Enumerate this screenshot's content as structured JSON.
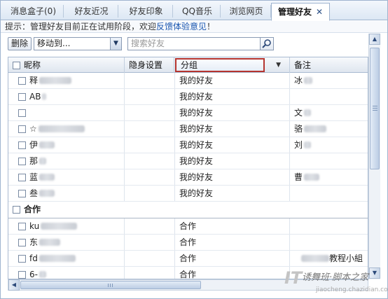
{
  "tabs": [
    {
      "label": "消息盒子(0)",
      "active": false
    },
    {
      "label": "好友近况",
      "active": false
    },
    {
      "label": "好友印象",
      "active": false
    },
    {
      "label": "QQ音乐",
      "active": false
    },
    {
      "label": "浏览网页",
      "active": false
    },
    {
      "label": "管理好友",
      "active": true,
      "close": "✕"
    }
  ],
  "notice": {
    "text": "提示：管理好友目前正在试用阶段，欢迎",
    "link": "反馈体验意见",
    "suffix": "！"
  },
  "toolbar": {
    "delete_label": "删除",
    "move_to_label": "移动到...",
    "search_placeholder": "搜索好友"
  },
  "table": {
    "headers": {
      "nickname": "昵称",
      "invisible": "隐身设置",
      "group": "分组",
      "remark": "备注"
    },
    "rows": [
      {
        "nick": "释",
        "group": "我的好友",
        "remark": "冰"
      },
      {
        "nick": "AB",
        "group": "我的好友",
        "remark": ""
      },
      {
        "nick": "",
        "group": "我的好友",
        "remark": "文"
      },
      {
        "nick": "☆",
        "group": "我的好友",
        "remark": "骆"
      },
      {
        "nick": "伊",
        "group": "我的好友",
        "remark": "刘"
      },
      {
        "nick": "那",
        "group": "我的好友",
        "remark": ""
      },
      {
        "nick": "蓝",
        "group": "我的好友",
        "remark": "曹"
      },
      {
        "nick": "叁",
        "group": "我的好友",
        "remark": ""
      }
    ],
    "group_heading": "合作",
    "rows2": [
      {
        "nick": "ku",
        "group": "合作",
        "remark": ""
      },
      {
        "nick": "东",
        "group": "合作",
        "remark": ""
      },
      {
        "nick": "fd",
        "group": "合作",
        "remark": "教程小組"
      },
      {
        "nick": "6-",
        "group": "合作",
        "remark": ""
      }
    ]
  },
  "watermark": {
    "line1": "诱舞班·脚本之家",
    "line2": "jiaocheng.chazidian.com",
    "logo": "IT"
  },
  "colors": {
    "highlight_border": "#b5342f",
    "link": "#1a56b0",
    "frame": "#9fb4cf"
  }
}
